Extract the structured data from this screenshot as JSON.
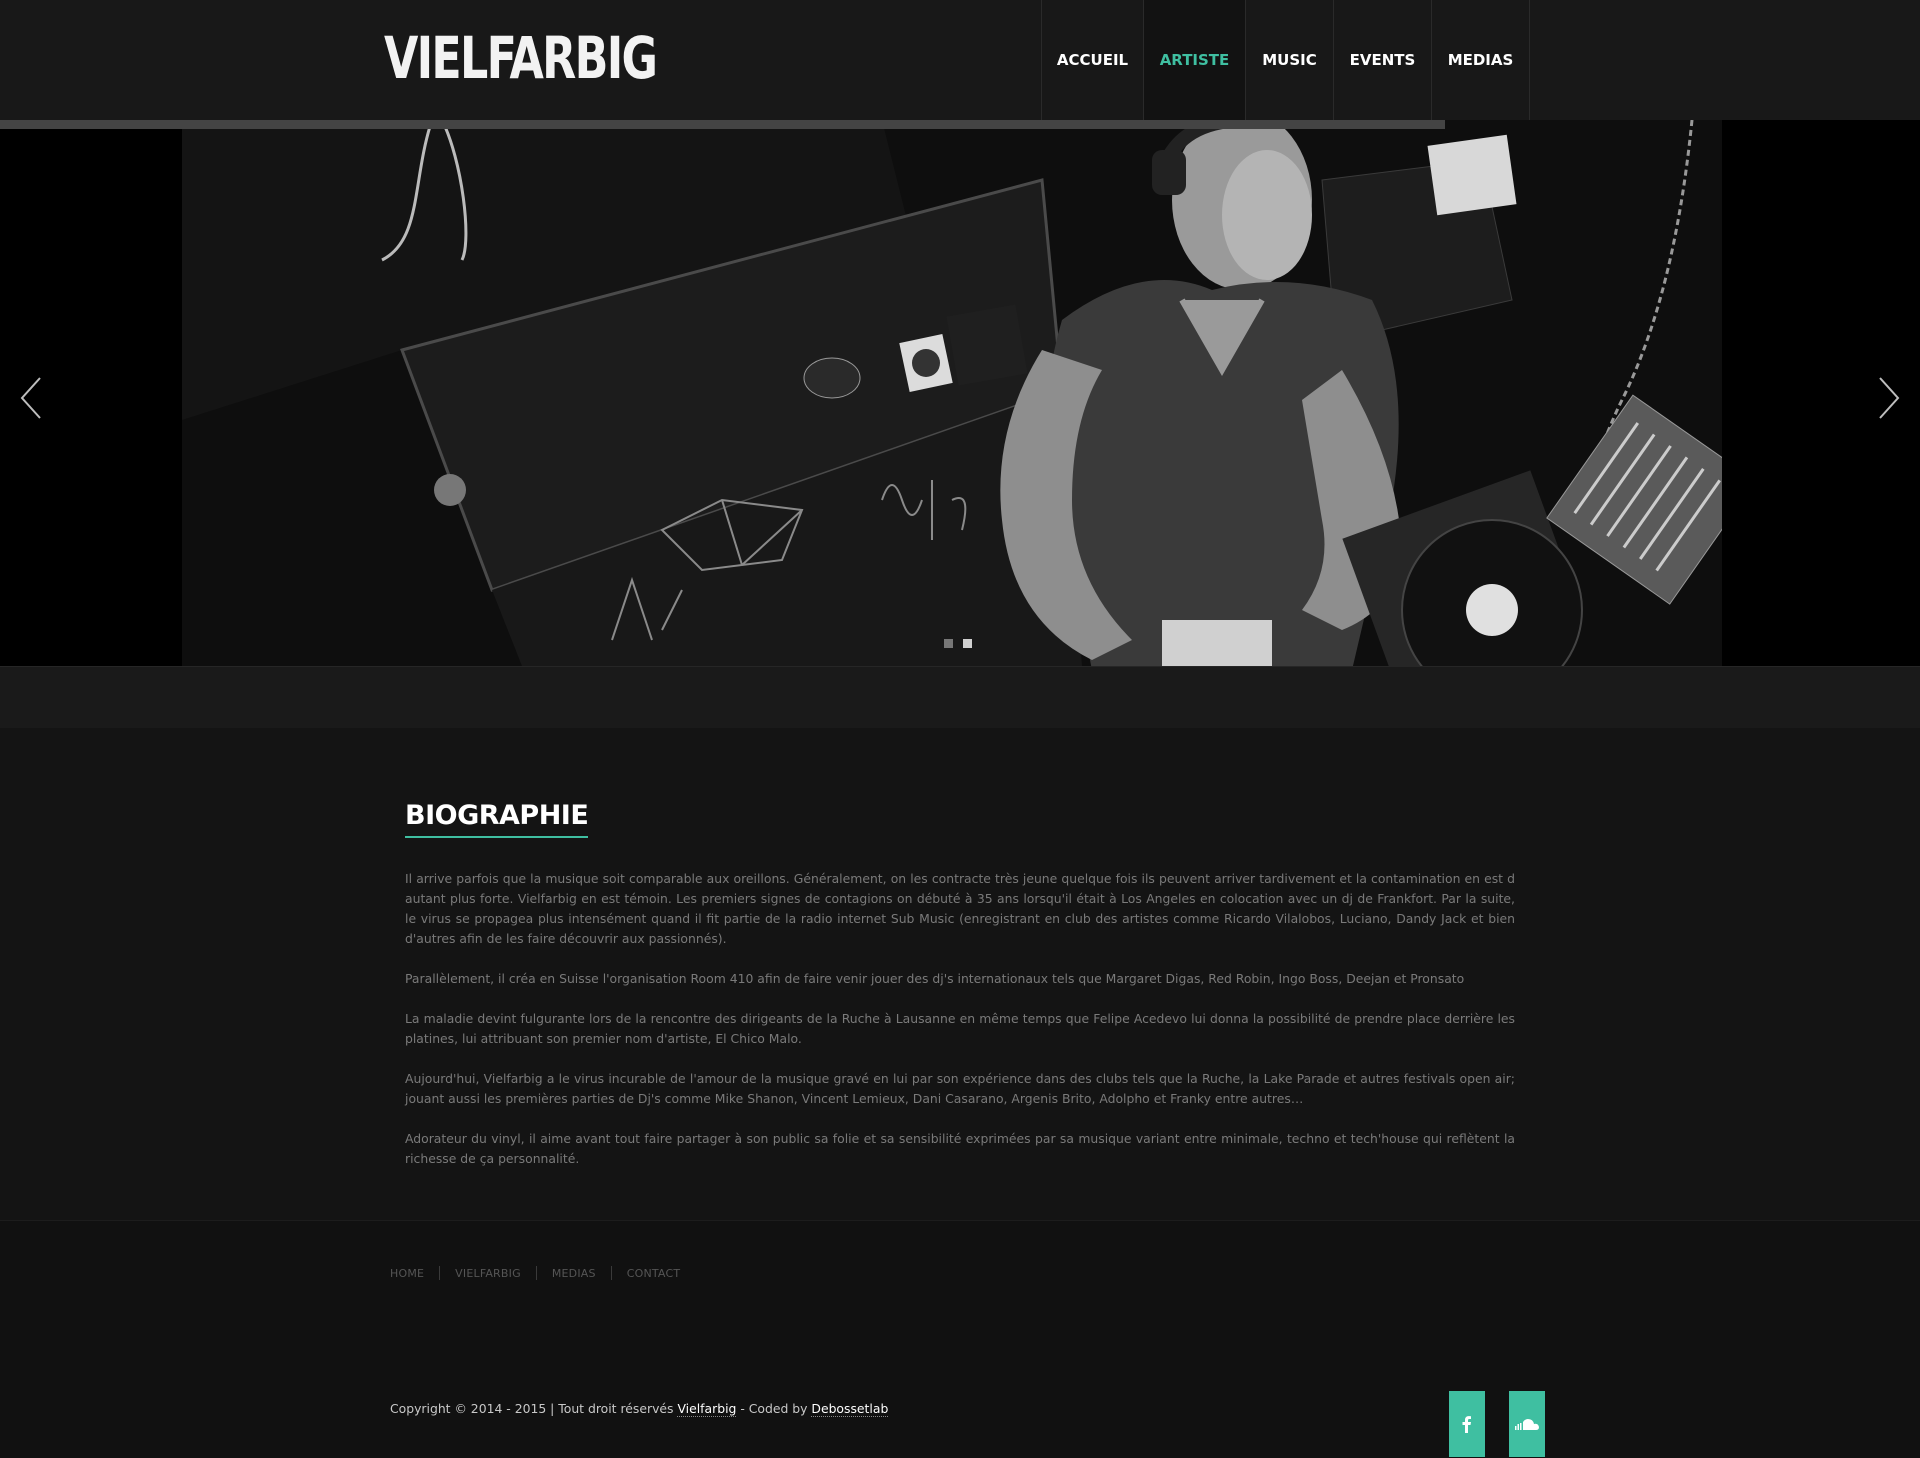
{
  "brand": {
    "name": "VIELFARBIG"
  },
  "nav": {
    "items": [
      {
        "label": "ACCUEIL",
        "active": false
      },
      {
        "label": "ARTISTE",
        "active": true
      },
      {
        "label": "MUSIC",
        "active": false
      },
      {
        "label": "EVENTS",
        "active": false
      },
      {
        "label": "MEDIAS",
        "active": false
      }
    ]
  },
  "slider": {
    "slide_count": 2,
    "active_slide": 2,
    "prev_icon": "chevron-left-icon",
    "next_icon": "chevron-right-icon"
  },
  "biography": {
    "title": "BIOGRAPHIE",
    "paragraphs": [
      "Il arrive parfois que la  musique soit comparable aux oreillons. Généralement, on  les contracte  très jeune quelque fois ils  peuvent arriver tardivement et la contamination en est d autant plus forte. Vielfarbig en  est témoin. Les premiers  signes de  contagions on débuté à 35 ans lorsqu'il était à Los Angeles en colocation avec un dj de Frankfort. Par la suite, le virus se propagea plus intensément quand il fit partie de la radio internet  Sub Music (enregistrant en club des artistes comme Ricardo Vilalobos, Luciano, Dandy Jack et bien d'autres afin de les faire découvrir aux passionnés).",
      "Parallèlement, il créa en Suisse l'organisation Room 410  afin  de faire venir  jouer  des dj's internationaux tels que Margaret Digas, Red Robin, Ingo Boss, Deejan et Pronsato",
      "La maladie devint fulgurante lors de la rencontre des dirigeants de la Ruche à Lausanne en même temps que Felipe Acedevo lui donna la possibilité de  prendre place derrière les platines, lui attribuant son premier nom d'artiste, El Chico Malo.",
      "Aujourd'hui, Vielfarbig a le virus incurable de l'amour de la musique gravé en lui par son expérience dans des clubs tels que la Ruche, la Lake Parade et autres festivals open air; jouant aussi les premières parties de Dj's comme Mike Shanon, Vincent Lemieux, Dani Casarano, Argenis Brito, Adolpho et Franky entre autres…",
      "Adorateur du vinyl, il aime avant tout faire partager à son public sa folie et sa sensibilité exprimées par sa musique  variant entre minimale, techno et tech'house qui reflètent la richesse de ça personnalité."
    ]
  },
  "footer": {
    "links": [
      "HOME",
      "VIELFARBIG",
      "MEDIAS",
      "CONTACT"
    ],
    "copyright_prefix": "Copyright © 2014 - 2015 | Tout droit réservés ",
    "copyright_brand": "Vielfarbig",
    "copyright_middle": " - Coded by ",
    "copyright_coder": "Debossetlab",
    "social": [
      {
        "icon": "facebook-icon"
      },
      {
        "icon": "soundcloud-icon"
      }
    ]
  },
  "colors": {
    "accent": "#3fbfa1",
    "background": "#121212",
    "header": "#181818"
  }
}
